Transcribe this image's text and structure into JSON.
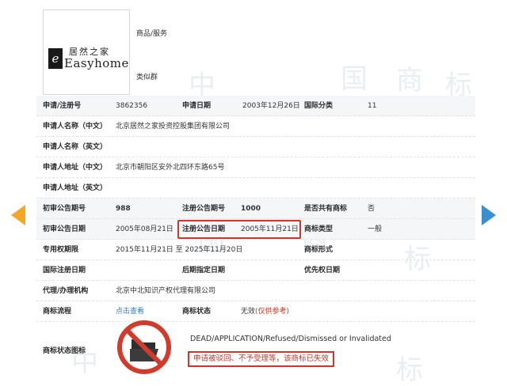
{
  "watermark": [
    "中",
    "国",
    "商",
    "标"
  ],
  "logo": {
    "mark": "e",
    "cn": "居然之家",
    "en": "Easyhome"
  },
  "header": {
    "goods_label": "商品/服务",
    "similar_label": "类似群"
  },
  "rows": {
    "r1": {
      "l1": "申请/注册号",
      "v1": "3862356",
      "l2": "申请日期",
      "v2": "2003年12月26日",
      "l3": "国际分类",
      "v3": "11"
    },
    "r2": {
      "l1": "申请人名称（中文）",
      "v1": "北京居然之家投资控股集团有限公司"
    },
    "r3": {
      "l1": "申请人名称（英文）"
    },
    "r4": {
      "l1": "申请人地址（中文）",
      "v1": "北京市朝阳区安外北四环东路65号"
    },
    "r5": {
      "l1": "申请人地址（英文）"
    },
    "r6": {
      "l1": "初审公告期号",
      "v1": "988",
      "l2": "注册公告期号",
      "v2": "1000",
      "l3": "是否共有商标",
      "v3": "否"
    },
    "r7": {
      "l1": "初审公告日期",
      "v1": "2005年08月21日",
      "l2": "注册公告日期",
      "v2": "2005年11月21日",
      "l3": "商标类型",
      "v3": "一般"
    },
    "r8": {
      "l1": "专用权期限",
      "v1": "2015年11月21日 至 2025年11月20日",
      "l3": "商标形式"
    },
    "r9": {
      "l1": "国际注册日期",
      "l2": "后期指定日期",
      "l3": "优先权日期"
    },
    "r10": {
      "l1": "代理/办理机构",
      "v1": "北京中北知识产权代理有限公司"
    },
    "r11": {
      "l1": "商标流程",
      "v1": "点击查看",
      "l2": "商标状态",
      "v2a": "无效",
      "v2b": "(仅供参考)"
    },
    "r12": {
      "l1": "商标状态图标"
    }
  },
  "status": {
    "dead_text": "DEAD/APPLICATION/Refused/Dismissed or Invalidated",
    "note": "申请被驳回、不予受理等，该商标已失效"
  },
  "colors": {
    "highlight": "#d0342c",
    "link": "#3a7bbf",
    "arrow_left": "#f5a623",
    "arrow_right": "#3a8fd0"
  }
}
